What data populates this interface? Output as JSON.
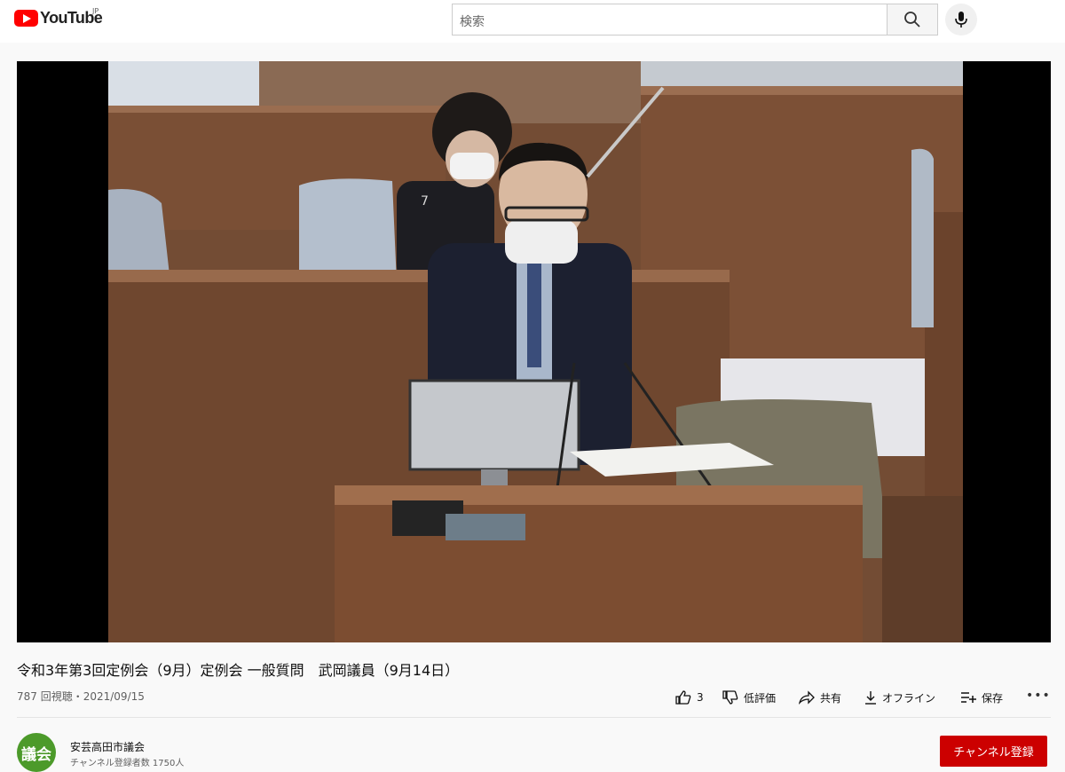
{
  "header": {
    "logo_text": "YouTube",
    "region": "JP",
    "search_placeholder": "検索"
  },
  "video": {
    "title": "令和3年第3回定例会（9月）定例会 一般質問　武岡議員（9月14日）",
    "meta": "787 回視聴・2021/09/15",
    "nameplate": "7"
  },
  "actions": {
    "like_count": "3",
    "dislike_label": "低評価",
    "share_label": "共有",
    "offline_label": "オフライン",
    "save_label": "保存",
    "more_label": "•••"
  },
  "channel": {
    "avatar_text": "議会",
    "name": "安芸高田市議会",
    "subscribers": "チャンネル登録者数 1750人",
    "subscribe_label": "チャンネル登録",
    "avatar_color": "#4c9a2a"
  },
  "colors": {
    "brand_red": "#ff0000",
    "subscribe_red": "#cc0000"
  }
}
